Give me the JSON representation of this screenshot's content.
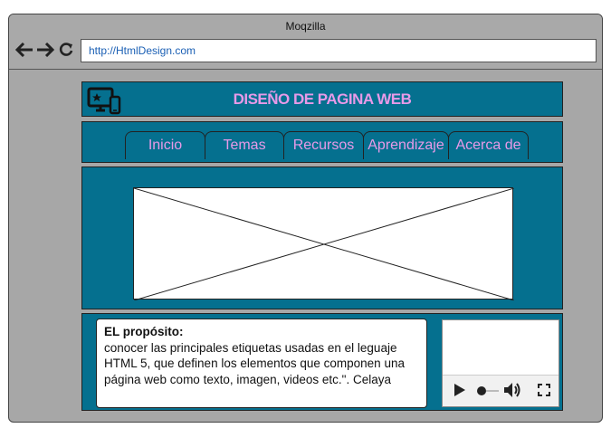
{
  "window": {
    "title": "Moqzilla"
  },
  "toolbar": {
    "back_icon": "back-arrow-icon",
    "forward_icon": "forward-arrow-icon",
    "reload_icon": "reload-icon",
    "url": "http://HtmlDesign.com"
  },
  "header": {
    "logo_icon": "devices-icon",
    "title": "DISEÑO DE PAGINA WEB"
  },
  "menu": {
    "tabs": [
      {
        "label": "Inicio"
      },
      {
        "label": "Temas"
      },
      {
        "label": "Recursos"
      },
      {
        "label": "Aprendizaje"
      },
      {
        "label": "Acerca de"
      }
    ]
  },
  "content": {
    "heading": "EL propósito:",
    "body": "conocer las principales etiquetas  usadas en el leguaje HTML 5, que definen    los elementos que componen una página web como texto, imagen, videos etc.\". Celaya"
  },
  "video": {
    "controls": [
      "play-icon",
      "progress-handle",
      "volume-icon",
      "fullscreen-icon"
    ]
  },
  "colors": {
    "panel": "#05708f",
    "accent": "#e79ae8",
    "chrome": "#a7a7a7"
  }
}
